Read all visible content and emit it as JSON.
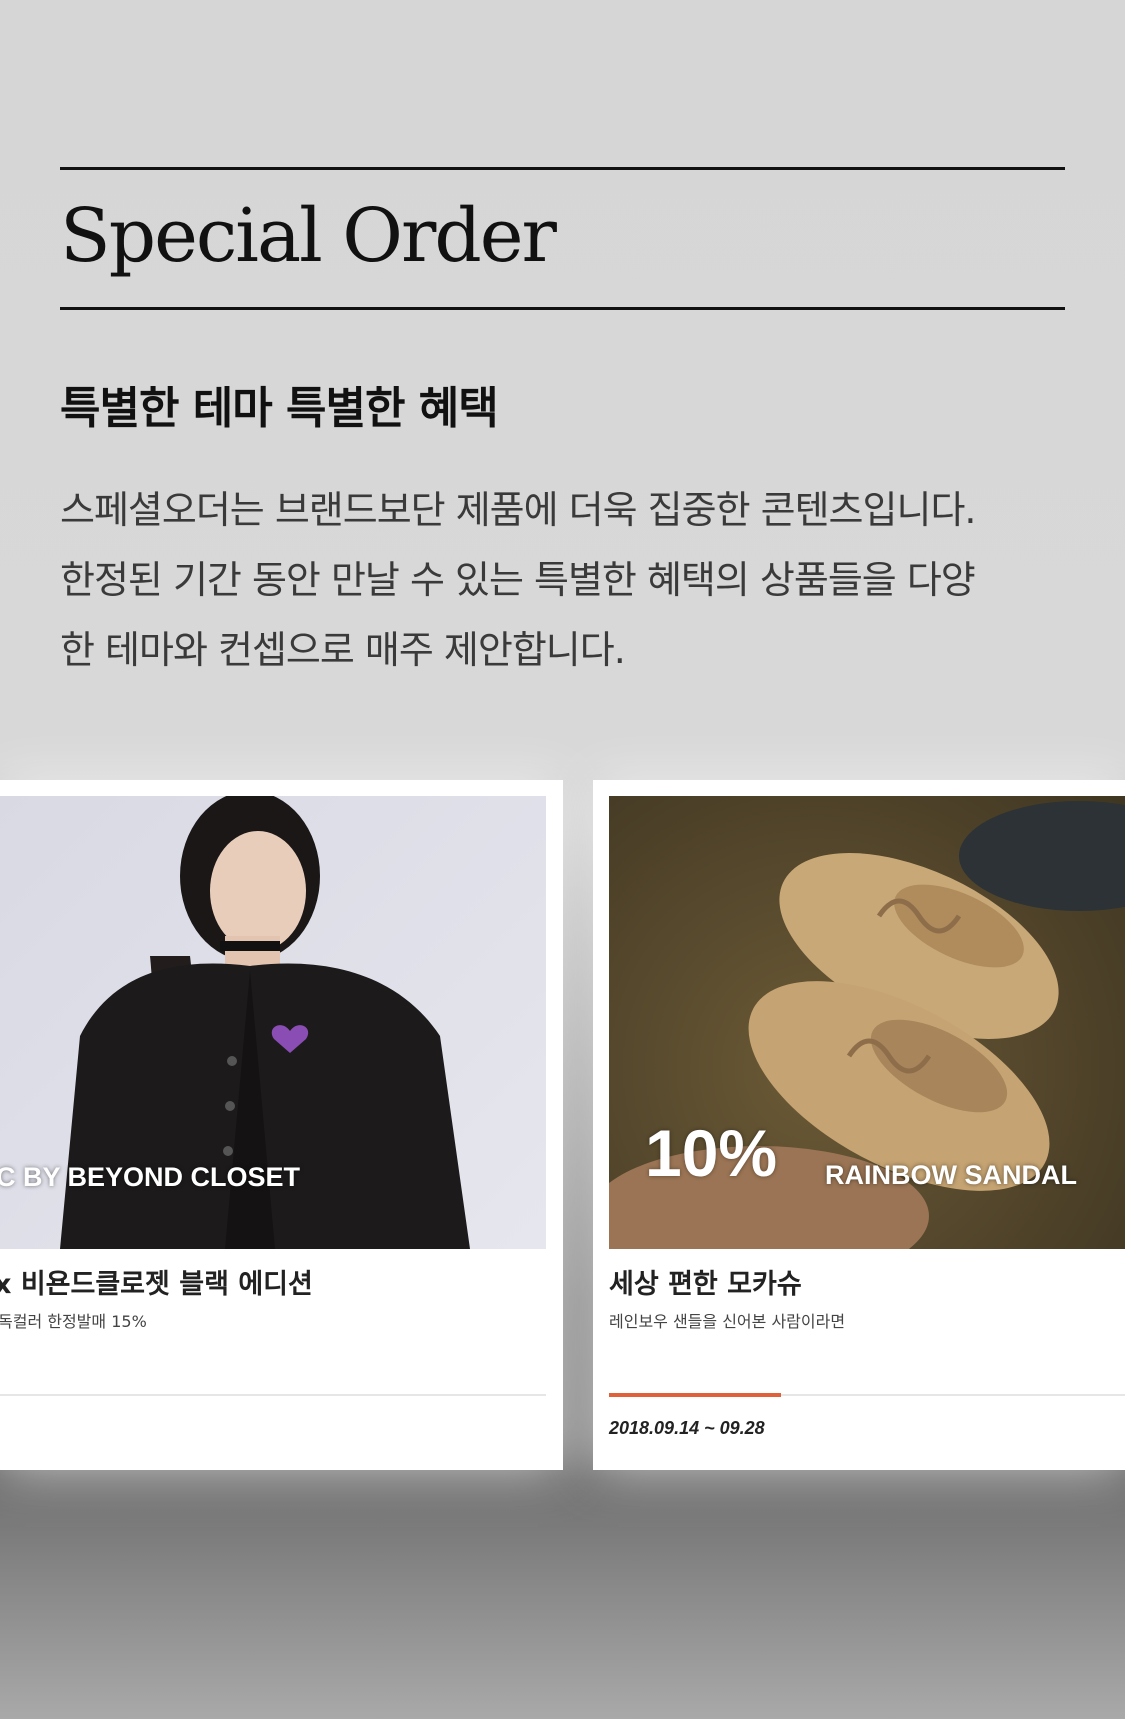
{
  "section": {
    "title": "Special Order",
    "subtitle": "특별한 테마 특별한 혜택",
    "description_lines": [
      "스페셜오더는 브랜드보단 제품에 더욱 집중한 콘텐츠입니다.",
      "한정된 기간 동안 만날 수 있는 특별한 혜택의 상품들을 다양",
      "한 테마와 컨셉으로 매주 제안합니다."
    ]
  },
  "cards": [
    {
      "overlay": "C BY BEYOND CLOSET",
      "title": "x 비욘드클로젯 블랙 에디션",
      "subtitle": "독컬러 한정발매 15%"
    },
    {
      "overlay_big": "10%",
      "overlay": "RAINBOW SANDAL",
      "title": "세상 편한 모카슈",
      "subtitle": "레인보우 샌들을 신어본 사람이라면",
      "date": "2018.09.14 ~ 09.28",
      "progress": 0.33
    }
  ]
}
